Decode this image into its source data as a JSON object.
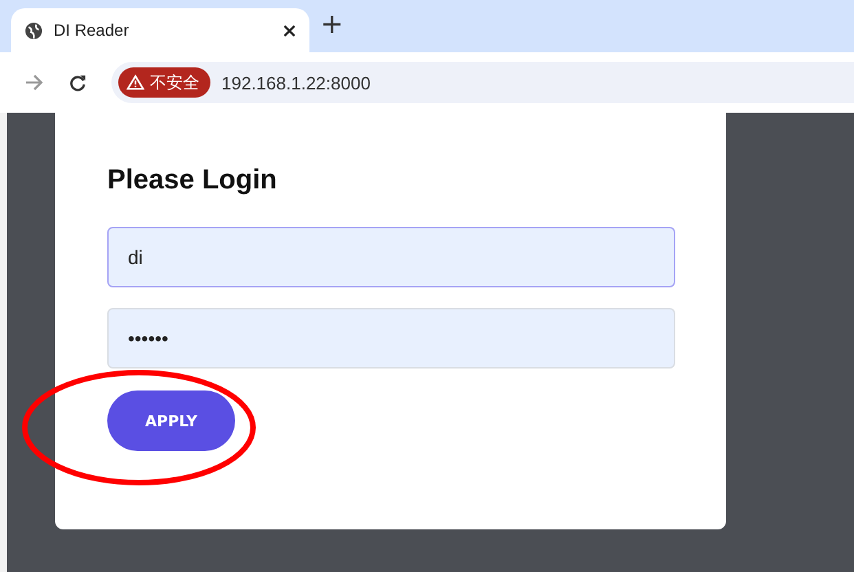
{
  "browser": {
    "tab": {
      "title": "DI Reader"
    },
    "new_tab": "+",
    "security_badge": "不安全",
    "address": "192.168.1.22:8000"
  },
  "login": {
    "title": "Please Login",
    "fields": [
      {
        "value": "di",
        "focused": true
      },
      {
        "value": "••••••",
        "focused": false
      }
    ],
    "button": "APPLY"
  }
}
